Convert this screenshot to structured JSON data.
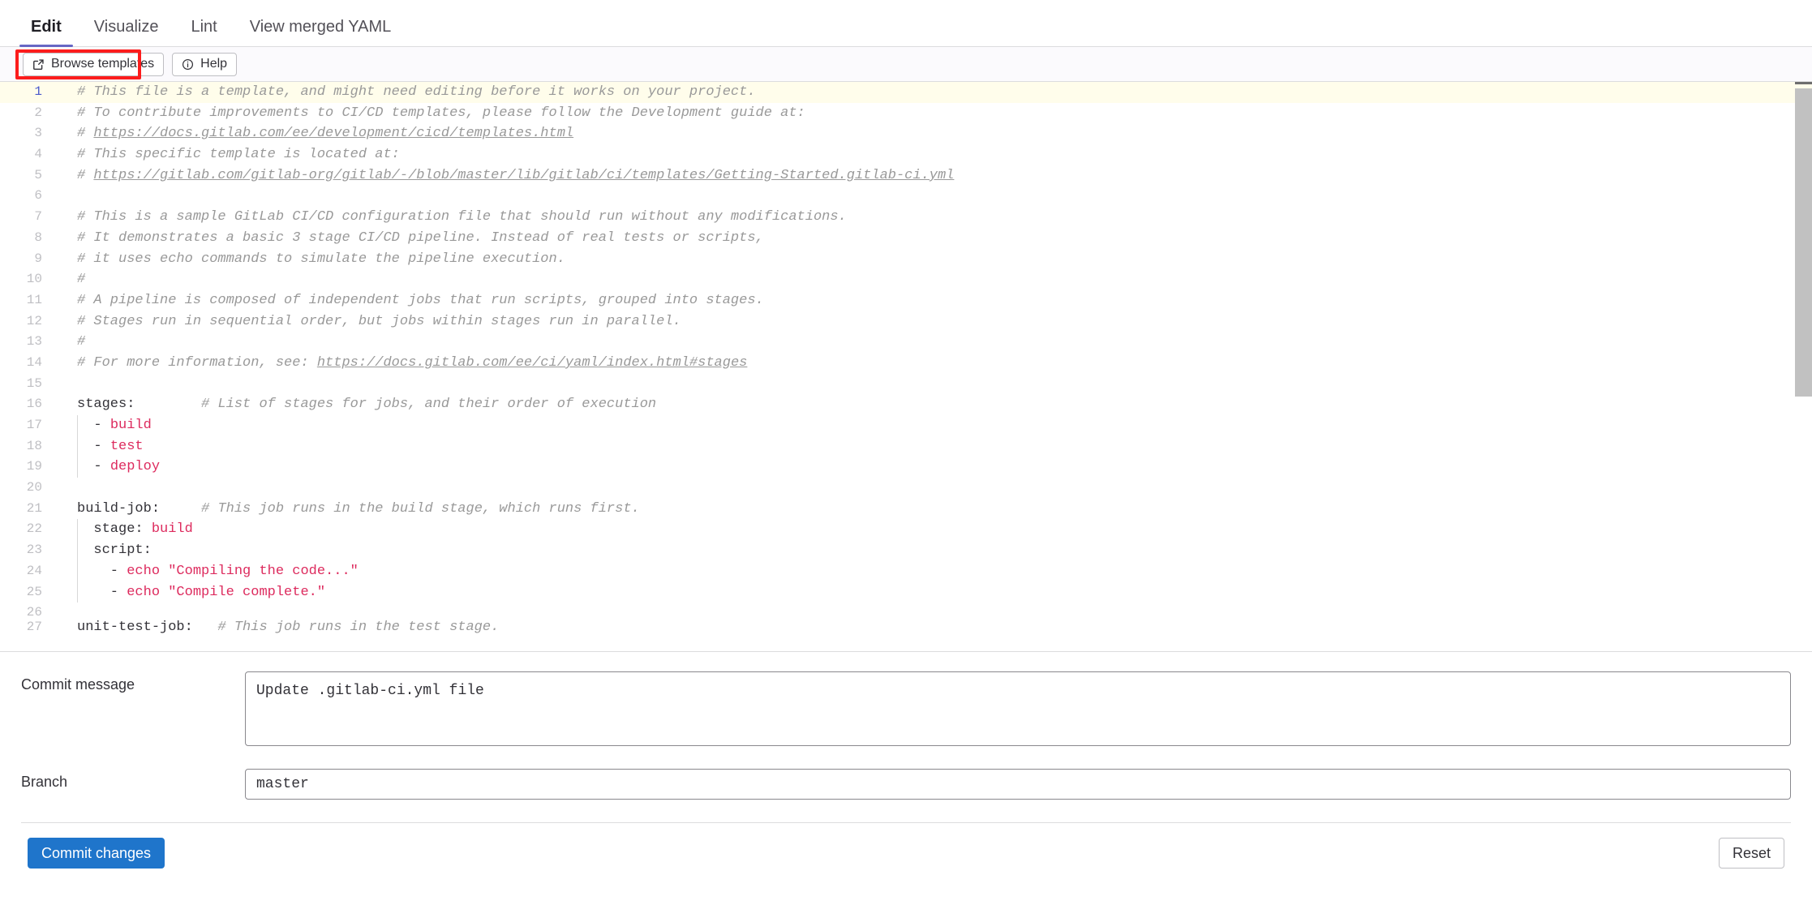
{
  "tabs": [
    {
      "label": "Edit",
      "active": true
    },
    {
      "label": "Visualize",
      "active": false
    },
    {
      "label": "Lint",
      "active": false
    },
    {
      "label": "View merged YAML",
      "active": false
    }
  ],
  "toolbar": {
    "browse_templates_label": "Browse templates",
    "browse_templates_icon": "external-link-icon",
    "help_label": "Help",
    "help_icon": "info-circle-icon",
    "highlight_color": "#fc1c1c"
  },
  "editor": {
    "language": "yaml",
    "highlighted_line": 1,
    "colors": {
      "comment": "#999999",
      "value": "#dd2b5e",
      "key": "#333238",
      "line_number": "#bfbfc3",
      "active_line_bg": "#fffdeb",
      "active_line_number": "#4c5acc"
    },
    "lines": [
      {
        "n": 1,
        "segments": [
          {
            "t": "cmt",
            "v": "# This file is a template, and might need editing before it works on your project."
          }
        ]
      },
      {
        "n": 2,
        "segments": [
          {
            "t": "cmt",
            "v": "# To contribute improvements to CI/CD templates, please follow the Development guide at:"
          }
        ]
      },
      {
        "n": 3,
        "segments": [
          {
            "t": "cmt",
            "v": "# "
          },
          {
            "t": "link",
            "v": "https://docs.gitlab.com/ee/development/cicd/templates.html"
          }
        ]
      },
      {
        "n": 4,
        "segments": [
          {
            "t": "cmt",
            "v": "# This specific template is located at:"
          }
        ]
      },
      {
        "n": 5,
        "segments": [
          {
            "t": "cmt",
            "v": "# "
          },
          {
            "t": "link",
            "v": "https://gitlab.com/gitlab-org/gitlab/-/blob/master/lib/gitlab/ci/templates/Getting-Started.gitlab-ci.yml"
          }
        ]
      },
      {
        "n": 6,
        "segments": []
      },
      {
        "n": 7,
        "segments": [
          {
            "t": "cmt",
            "v": "# This is a sample GitLab CI/CD configuration file that should run without any modifications."
          }
        ]
      },
      {
        "n": 8,
        "segments": [
          {
            "t": "cmt",
            "v": "# It demonstrates a basic 3 stage CI/CD pipeline. Instead of real tests or scripts,"
          }
        ]
      },
      {
        "n": 9,
        "segments": [
          {
            "t": "cmt",
            "v": "# it uses echo commands to simulate the pipeline execution."
          }
        ]
      },
      {
        "n": 10,
        "segments": [
          {
            "t": "cmt",
            "v": "#"
          }
        ]
      },
      {
        "n": 11,
        "segments": [
          {
            "t": "cmt",
            "v": "# A pipeline is composed of independent jobs that run scripts, grouped into stages."
          }
        ]
      },
      {
        "n": 12,
        "segments": [
          {
            "t": "cmt",
            "v": "# Stages run in sequential order, but jobs within stages run in parallel."
          }
        ]
      },
      {
        "n": 13,
        "segments": [
          {
            "t": "cmt",
            "v": "#"
          }
        ]
      },
      {
        "n": 14,
        "segments": [
          {
            "t": "cmt",
            "v": "# For more information, see: "
          },
          {
            "t": "link",
            "v": "https://docs.gitlab.com/ee/ci/yaml/index.html#stages"
          }
        ]
      },
      {
        "n": 15,
        "segments": []
      },
      {
        "n": 16,
        "segments": [
          {
            "t": "key",
            "v": "stages:"
          },
          {
            "t": "cmt",
            "v": "        # List of stages for jobs, and their order of execution"
          }
        ]
      },
      {
        "n": 17,
        "indent": 1,
        "segments": [
          {
            "t": "punct",
            "v": "  - "
          },
          {
            "t": "val",
            "v": "build"
          }
        ]
      },
      {
        "n": 18,
        "indent": 1,
        "segments": [
          {
            "t": "punct",
            "v": "  - "
          },
          {
            "t": "val",
            "v": "test"
          }
        ]
      },
      {
        "n": 19,
        "indent": 1,
        "segments": [
          {
            "t": "punct",
            "v": "  - "
          },
          {
            "t": "val",
            "v": "deploy"
          }
        ]
      },
      {
        "n": 20,
        "segments": []
      },
      {
        "n": 21,
        "segments": [
          {
            "t": "key",
            "v": "build-job:"
          },
          {
            "t": "cmt",
            "v": "     # This job runs in the build stage, which runs first."
          }
        ]
      },
      {
        "n": 22,
        "indent": 1,
        "segments": [
          {
            "t": "key",
            "v": "  stage: "
          },
          {
            "t": "val",
            "v": "build"
          }
        ]
      },
      {
        "n": 23,
        "indent": 1,
        "segments": [
          {
            "t": "key",
            "v": "  script:"
          }
        ]
      },
      {
        "n": 24,
        "indent": 1,
        "segments": [
          {
            "t": "punct",
            "v": "    - "
          },
          {
            "t": "val",
            "v": "echo \"Compiling the code...\""
          }
        ]
      },
      {
        "n": 25,
        "indent": 1,
        "segments": [
          {
            "t": "punct",
            "v": "    - "
          },
          {
            "t": "val",
            "v": "echo \"Compile complete.\""
          }
        ]
      },
      {
        "n": 26,
        "segments": []
      },
      {
        "n": 27,
        "clipped": true,
        "segments": [
          {
            "t": "key",
            "v": "unit-test-job:"
          },
          {
            "t": "cmt",
            "v": "   # This job runs in the test stage."
          }
        ]
      }
    ]
  },
  "form": {
    "commit_message_label": "Commit message",
    "commit_message_value": "Update .gitlab-ci.yml file",
    "branch_label": "Branch",
    "branch_value": "master"
  },
  "footer": {
    "commit_label": "Commit changes",
    "reset_label": "Reset",
    "primary_color": "#1f75cb"
  }
}
